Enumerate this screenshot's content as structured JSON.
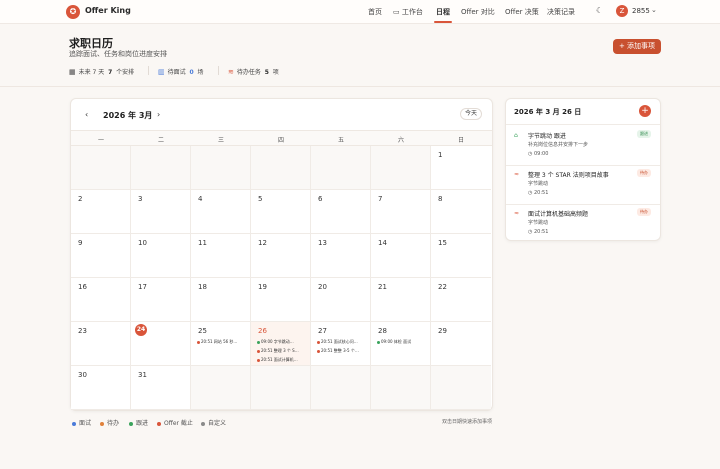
{
  "nav": {
    "brand": "Offer King",
    "items": [
      "首页",
      "工作台",
      "日程",
      "Offer 对比",
      "Offer 决策",
      "决策记录"
    ],
    "avatar_letter": "Z",
    "points": "2855"
  },
  "header": {
    "title": "求职日历",
    "subtitle": "追踪面试、任务和岗位进度安排",
    "add_button": "+ 添加事项",
    "stats": [
      {
        "label": "未来 7 天",
        "value": "7",
        "suffix": "个安排"
      },
      {
        "label": "待面试",
        "value": "0",
        "suffix": "场"
      },
      {
        "label": "待办任务",
        "value": "5",
        "suffix": "项"
      }
    ]
  },
  "calendar": {
    "month": "2026 年 3月",
    "today_button": "今天",
    "weekdays": [
      "一",
      "二",
      "三",
      "四",
      "五",
      "六",
      "日"
    ],
    "selected_day": "26",
    "today_day": "24",
    "events": {
      "25": [
        {
          "text": "20:51 网站 56 秒…",
          "color": "#d9553a"
        }
      ],
      "26": [
        {
          "text": "09:00 字节跳动…",
          "color": "#3aa35c"
        },
        {
          "text": "20:51 整理 3 个 S…",
          "color": "#d9553a"
        },
        {
          "text": "20:51 面试计算机…",
          "color": "#d9553a"
        }
      ],
      "27": [
        {
          "text": "20:51 面试核心问…",
          "color": "#d9553a"
        },
        {
          "text": "20:51 整整 3-5 个…",
          "color": "#d9553a"
        }
      ],
      "28": [
        {
          "text": "09:00 体检 面试",
          "color": "#3aa35c"
        }
      ]
    }
  },
  "legend": {
    "items": [
      {
        "label": "面试",
        "color": "#4a7bd9"
      },
      {
        "label": "待办",
        "color": "#e0813a"
      },
      {
        "label": "跟进",
        "color": "#3aa35c"
      },
      {
        "label": "Offer 截止",
        "color": "#d9553a"
      },
      {
        "label": "自定义",
        "color": "#8a8a8a"
      }
    ],
    "hint": "双击日期快速添加事项"
  },
  "side": {
    "title": "2026 年 3 月 26 日",
    "tasks": [
      {
        "title": "字节跳动 跟进",
        "sub": "补充岗位信息并安排下一步",
        "time": "09:00",
        "badge": "跟进",
        "badge_bg": "#e6f4ea",
        "badge_fg": "#2f8a4c",
        "icon": "⌂",
        "icon_color": "#3aa35c"
      },
      {
        "title": "整理 3 个 STAR 法则项目故事",
        "sub": "字节跳动",
        "time": "20:51",
        "badge": "待办",
        "badge_bg": "#fdeae3",
        "badge_fg": "#c8502f",
        "icon": "≈",
        "icon_color": "#d9553a"
      },
      {
        "title": "面试计算机基础高频题",
        "sub": "字节跳动",
        "time": "20:51",
        "badge": "待办",
        "badge_bg": "#fdeae3",
        "badge_fg": "#c8502f",
        "icon": "≈",
        "icon_color": "#d9553a"
      }
    ]
  },
  "colors": {
    "accent": "#d9553a"
  }
}
